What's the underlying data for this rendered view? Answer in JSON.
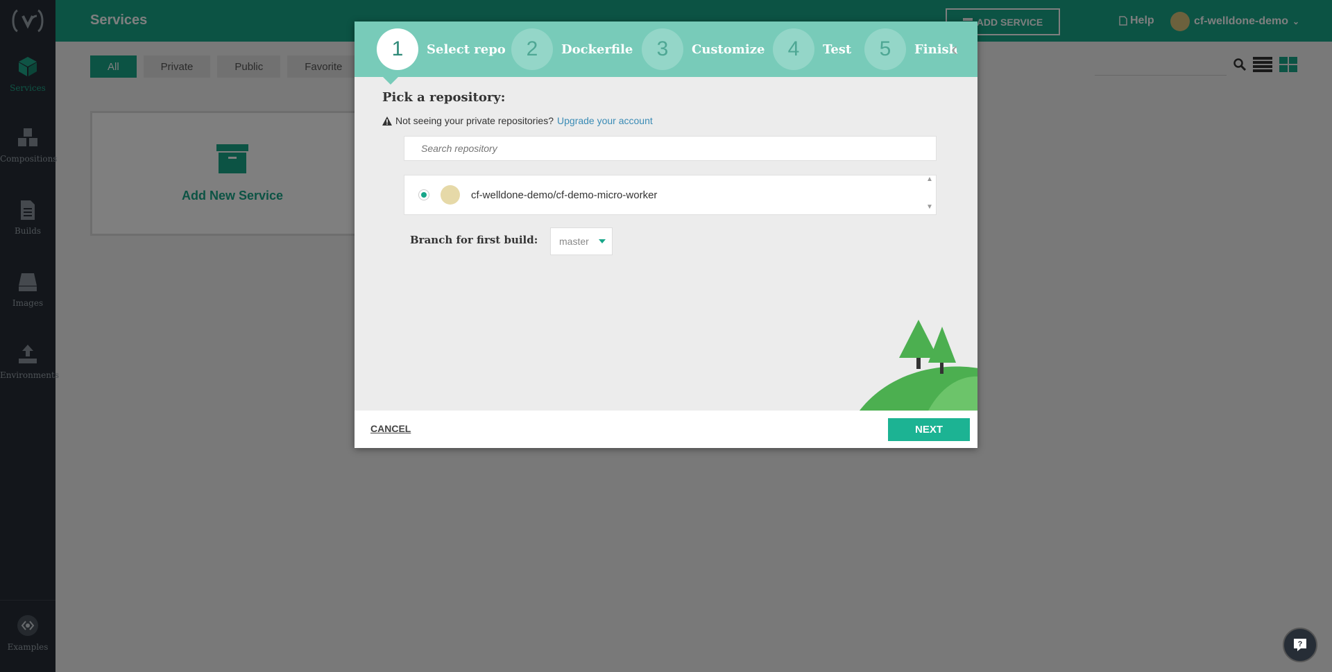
{
  "sidebar": {
    "items": [
      {
        "label": "Services"
      },
      {
        "label": "Compositions"
      },
      {
        "label": "Builds"
      },
      {
        "label": "Images"
      },
      {
        "label": "Environments"
      }
    ],
    "bottom": {
      "label": "Examples"
    }
  },
  "header": {
    "title": "Services",
    "add_service_label": "ADD SERVICE",
    "help_label": "Help",
    "username": "cf-welldone-demo"
  },
  "filters": [
    "All",
    "Private",
    "Public",
    "Favorite"
  ],
  "add_card": {
    "label": "Add New Service"
  },
  "modal": {
    "steps": [
      {
        "num": "1",
        "label": "Select repo"
      },
      {
        "num": "2",
        "label": "Dockerfile"
      },
      {
        "num": "3",
        "label": "Customize"
      },
      {
        "num": "4",
        "label": "Test"
      },
      {
        "num": "5",
        "label": "Finish"
      }
    ],
    "title": "Pick a repository:",
    "notice_text": "Not seeing your private repositories?",
    "notice_link": "Upgrade your account",
    "search_placeholder": "Search repository",
    "repos": [
      {
        "name": "cf-welldone-demo/cf-demo-micro-worker",
        "selected": true
      }
    ],
    "branch_label": "Branch for first build:",
    "branch_value": "master",
    "cancel_label": "CANCEL",
    "next_label": "NEXT"
  },
  "colors": {
    "brand": "#18a689",
    "sidebar_bg": "#262d36",
    "steps_bg": "#78cbb9",
    "next_button": "#1cb393"
  }
}
